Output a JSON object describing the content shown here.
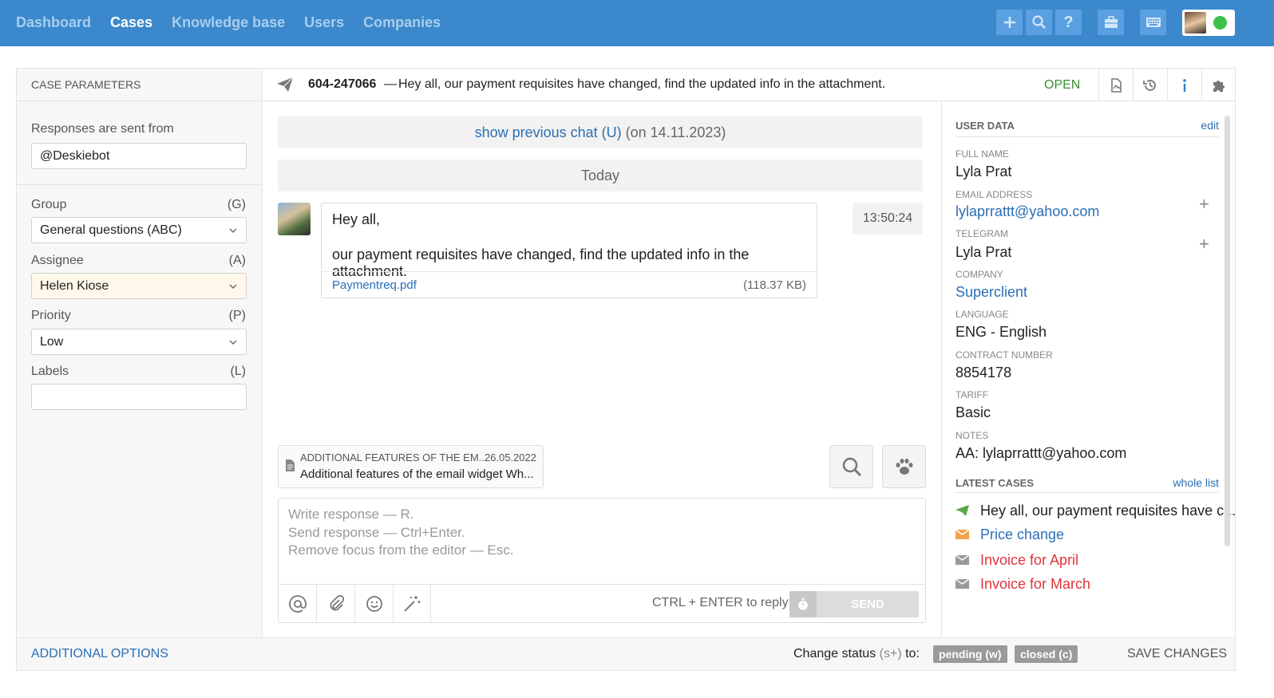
{
  "nav": {
    "items": [
      "Dashboard",
      "Cases",
      "Knowledge base",
      "Users",
      "Companies"
    ],
    "active": "Cases"
  },
  "toolbar": {
    "buttons": [
      "plus-icon",
      "search-icon",
      "help-icon",
      "briefcase-icon",
      "keyboard-icon"
    ],
    "user_status": "online",
    "status_color": "#3bc24a",
    "accent": "#3b89cc"
  },
  "left": {
    "title": "CASE PARAMETERS",
    "sent_from_label": "Responses are sent from",
    "sent_from_value": "@Deskiebot",
    "group_label": "Group",
    "group_key": "(G)",
    "group_value": "General questions (ABC)",
    "assignee_label": "Assignee",
    "assignee_key": "(A)",
    "assignee_value": "Helen Kiose",
    "priority_label": "Priority",
    "priority_key": "(P)",
    "priority_value": "Low",
    "labels_label": "Labels",
    "labels_key": "(L)",
    "labels_value": ""
  },
  "header": {
    "case_number": "604-247066",
    "dash": "—",
    "subject": "Hey all, our payment requisites have changed, find the updated info in the attachment.",
    "status": "OPEN",
    "icons": [
      "document-icon",
      "history-icon",
      "info-icon",
      "puzzle-icon"
    ]
  },
  "chat": {
    "previous_link": "show previous chat (U)",
    "previous_date": "(on 14.11.2023)",
    "day": "Today",
    "message": {
      "line1": "Hey all,",
      "line2": "our payment requisites have changed, find the updated info in the attachment.",
      "attachment_name": "Paymentreq.pdf",
      "attachment_size": "(118.37 KB)",
      "time": "13:50:24"
    },
    "kb_suggestion": {
      "title": "ADDITIONAL FEATURES OF THE EM...",
      "date": "26.05.2022",
      "body": "Additional features of the email widget Wh..."
    }
  },
  "editor": {
    "hint1": "Write response — R.",
    "hint2": "Send response — Ctrl+Enter.",
    "hint3": "Remove focus from the editor — Esc.",
    "ctrl_hint": "CTRL + ENTER to reply",
    "send_label": "SEND"
  },
  "user_data": {
    "title": "USER DATA",
    "edit_label": "edit",
    "fields": [
      {
        "label": "FULL NAME",
        "value": "Lyla Prat"
      },
      {
        "label": "EMAIL ADDRESS",
        "value": "lylaprrattt@yahoo.com"
      },
      {
        "label": "TELEGRAM",
        "value": "Lyla Prat"
      },
      {
        "label": "COMPANY",
        "value": "Superclient"
      },
      {
        "label": "LANGUAGE",
        "value": "ENG - English"
      },
      {
        "label": "CONTRACT NUMBER",
        "value": "8854178"
      },
      {
        "label": "TARIFF",
        "value": "Basic"
      },
      {
        "label": "NOTES",
        "value": "AA: lylaprrattt@yahoo.com"
      }
    ],
    "plus": "+"
  },
  "latest_cases": {
    "title": "LATEST CASES",
    "link": "whole list",
    "items": [
      {
        "icon": "telegram-icon",
        "title": "Hey all, our payment requisites have c...",
        "color": "#222222"
      },
      {
        "icon": "email-icon",
        "title": "Price change",
        "color": "#2b6eb5"
      },
      {
        "icon": "email-icon",
        "title": "Invoice for April",
        "color": "#e0343a"
      },
      {
        "icon": "email-icon",
        "title": "Invoice for March",
        "color": "#e0343a"
      }
    ]
  },
  "footer": {
    "additional_options": "ADDITIONAL OPTIONS",
    "change_status": "Change status",
    "change_status_key": "(s+)",
    "change_status_to": "to:",
    "pending_label": "pending (w)",
    "closed_label": "closed (c)",
    "save_label": "SAVE CHANGES"
  }
}
